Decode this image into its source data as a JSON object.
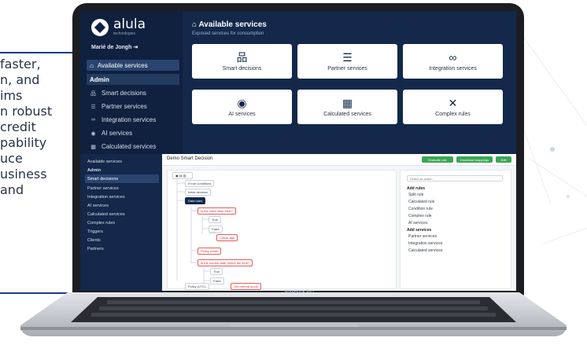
{
  "side_text": {
    "lines": [
      "faster,",
      "n, and",
      "ims",
      "n robust",
      "credit",
      "pability",
      "uce",
      "usiness",
      "and"
    ],
    "rule_color": "#1e3a8a"
  },
  "device": {
    "label": "NoteBook Pro"
  },
  "app1": {
    "logo": {
      "name": "alula",
      "tagline": "technologies"
    },
    "user": "Marié de Jongh",
    "nav_active": "Available services",
    "admin_header": "Admin",
    "sidebar": [
      {
        "icon": "tree-icon",
        "glyph": "品",
        "label": "Smart decisions"
      },
      {
        "icon": "list-icon",
        "glyph": "☰",
        "label": "Partner services"
      },
      {
        "icon": "link-icon",
        "glyph": "∞",
        "label": "Integration services"
      },
      {
        "icon": "robot-icon",
        "glyph": "◉",
        "label": "AI services"
      },
      {
        "icon": "calculator-icon",
        "glyph": "▦",
        "label": "Calculated services"
      }
    ],
    "page_title": "Available services",
    "page_subtitle": "Exposed services for consumption",
    "cards": [
      {
        "icon": "tree-icon",
        "glyph": "品",
        "label": "Smart decisions"
      },
      {
        "icon": "list-icon",
        "glyph": "☰",
        "label": "Partner services"
      },
      {
        "icon": "link-icon",
        "glyph": "∞",
        "label": "Integration services"
      },
      {
        "icon": "robot-icon",
        "glyph": "◉",
        "label": "AI services"
      },
      {
        "icon": "calculator-icon",
        "glyph": "▦",
        "label": "Calculated services"
      },
      {
        "icon": "tools-icon",
        "glyph": "✕",
        "label": "Complex rules"
      }
    ]
  },
  "app2": {
    "title": "Demo Smart Decision",
    "buttons": [
      "Evaluate rule",
      "Download mappings",
      "Edit"
    ],
    "sidebar": [
      {
        "label": "Available services",
        "active": false
      },
      {
        "label": "Admin",
        "active": false
      },
      {
        "label": "Smart decisions",
        "active": true
      },
      {
        "label": "Partner services",
        "active": false
      },
      {
        "label": "Integration services",
        "active": false
      },
      {
        "label": "AI services",
        "active": false
      },
      {
        "label": "Calculated services",
        "active": false
      },
      {
        "label": "Complex rules",
        "active": false
      },
      {
        "label": "Triggers",
        "active": false
      },
      {
        "label": "Clients",
        "active": false
      },
      {
        "label": "Partners",
        "active": false
      }
    ],
    "tree_nodes": [
      "If true conditions",
      "Initial decision",
      "Data rules",
      "Is the client Blue Alert?",
      "True",
      "False",
      "Check age",
      "Policy exists",
      "Is the current date before the limit?",
      "True",
      "False",
      "Get referral score",
      "Policy (UTC)"
    ],
    "right_panel": {
      "select": "Select an action",
      "groups": [
        {
          "header": "Add rules",
          "items": [
            "Split rule",
            "Calculated rule",
            "Condition rule",
            "Complex rule",
            "AI services"
          ]
        },
        {
          "header": "Add services",
          "items": [
            "Partner services",
            "Integration services",
            "Calculated services"
          ]
        }
      ]
    }
  }
}
